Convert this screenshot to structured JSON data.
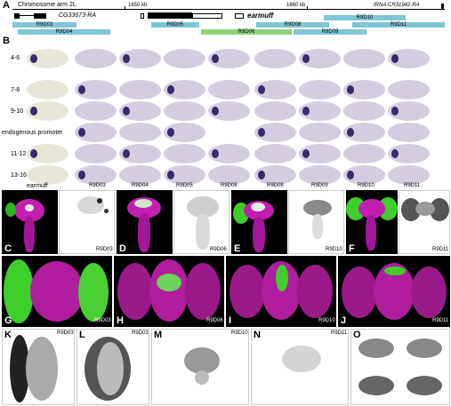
{
  "panel_A": {
    "letter": "A",
    "chrom_label": "Chromosome arm 2L",
    "coord1": "1650 kb",
    "coord2": "1660 kb",
    "gene_left": "CG33673-RA",
    "gene_main": "earmuff",
    "gene_right": "tRNA:CR31942-RA",
    "fragments": {
      "R9D03": "R9D03",
      "R9D04": "R9D04",
      "R9D05": "R9D05",
      "R9D06": "R9D06",
      "R9D08": "R9D08",
      "R9D09": "R9D09",
      "R9D10": "R9D10",
      "R9D11": "R9D11"
    }
  },
  "panel_B": {
    "letter": "B",
    "rows": [
      "4-6",
      "7-8",
      "9-10",
      "endogenous promoter",
      "11-12",
      "13-16"
    ],
    "columns": [
      "earmuff",
      "R9D03",
      "R9D04",
      "R9D05",
      "R9D06",
      "R9D08",
      "R9D09",
      "R9D10",
      "R9D11"
    ]
  },
  "row_CF": [
    {
      "letter": "C",
      "label": "R9D03"
    },
    {
      "letter": "D",
      "label": "R9D06"
    },
    {
      "letter": "E",
      "label": "R9D10"
    },
    {
      "letter": "F",
      "label": "R9D11"
    }
  ],
  "row_GJ": [
    {
      "letter": "G",
      "label": "R9D03"
    },
    {
      "letter": "H",
      "label": "R9D06"
    },
    {
      "letter": "I",
      "label": "R9D10"
    },
    {
      "letter": "J",
      "label": "R9D11"
    }
  ],
  "row_KO": [
    {
      "letter": "K",
      "label": "R9D03"
    },
    {
      "letter": "L",
      "label": "R9D03"
    },
    {
      "letter": "M",
      "label": "R9D10"
    },
    {
      "letter": "N",
      "label": "R9D11"
    },
    {
      "letter": "O",
      "label": ""
    }
  ],
  "colors": {
    "fragment_blue": "#7fc6d6",
    "fragment_green": "#8fd07a",
    "stain_purple": "#3a2a6a",
    "magenta": "#c21fb0",
    "gfp_green": "#3fcf2a"
  }
}
